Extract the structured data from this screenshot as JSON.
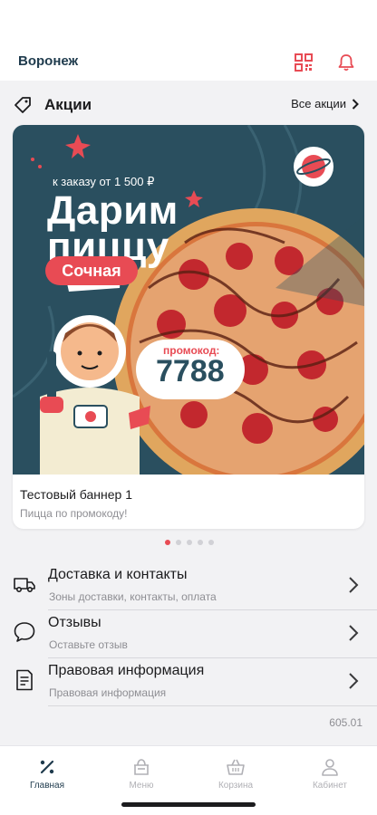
{
  "header": {
    "city": "Воронеж",
    "qr_icon": "qr-code-icon",
    "bell_icon": "bell-icon",
    "accent_color": "#e84b54"
  },
  "promotions": {
    "title": "Акции",
    "all_link": "Все акции",
    "banner": {
      "order_text": "к заказу от 1 500 ₽",
      "headline_line1": "Дарим",
      "headline_line2": "пиццу",
      "pill_text": "Сочная",
      "promo_label": "промокод:",
      "promo_code": "7788"
    },
    "card_title": "Тестовый баннер 1",
    "card_subtitle": "Пицца по промокоду!",
    "pager": {
      "count": 5,
      "active": 0
    }
  },
  "menu": [
    {
      "title": "Доставка и контакты",
      "subtitle": "Зоны доставки, контакты, оплата",
      "icon": "truck-icon"
    },
    {
      "title": "Отзывы",
      "subtitle": "Оставьте отзыв",
      "icon": "chat-bubble-icon"
    },
    {
      "title": "Правовая информация",
      "subtitle": "Правовая информация",
      "icon": "document-icon"
    }
  ],
  "version": "605.01",
  "tabs": [
    {
      "label": "Главная",
      "icon": "percent-icon",
      "active": true
    },
    {
      "label": "Меню",
      "icon": "menu-food-icon",
      "active": false
    },
    {
      "label": "Корзина",
      "icon": "basket-icon",
      "active": false
    },
    {
      "label": "Кабинет",
      "icon": "user-icon",
      "active": false
    }
  ]
}
